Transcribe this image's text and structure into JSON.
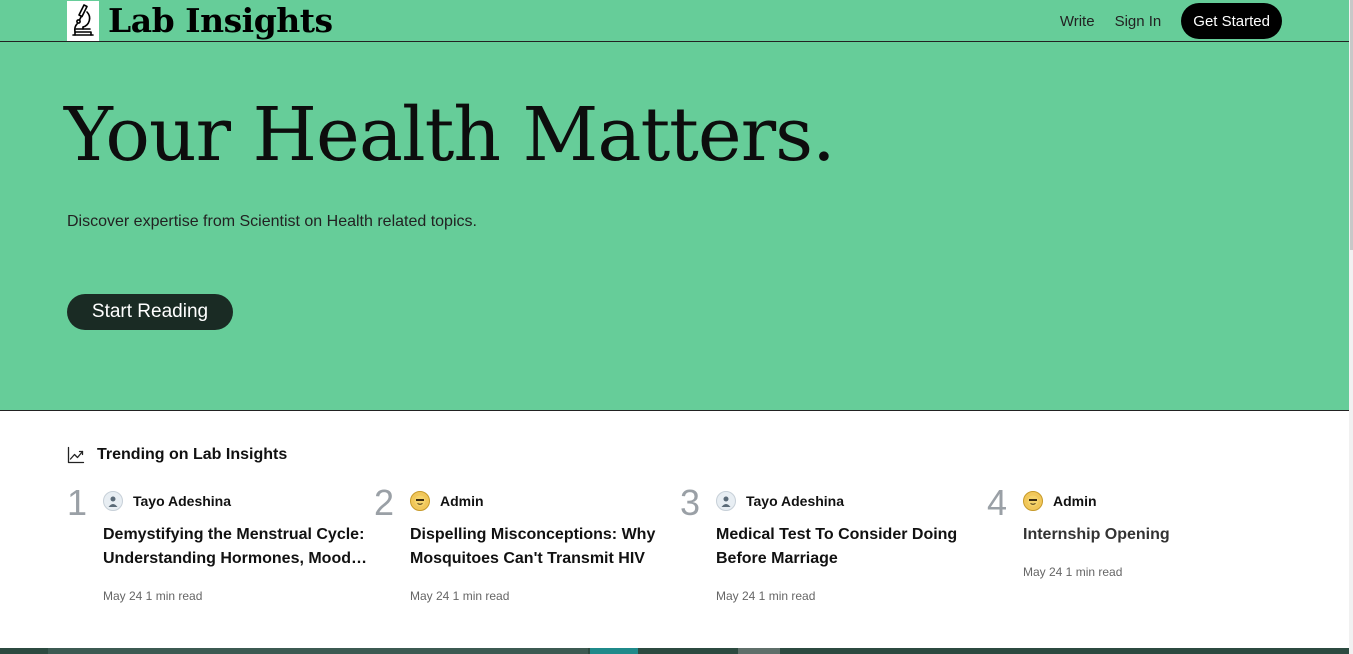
{
  "header": {
    "brand": "Lab Insights",
    "logo_icon": "microscope-icon",
    "nav": {
      "write": "Write",
      "sign_in": "Sign In",
      "get_started": "Get Started"
    }
  },
  "hero": {
    "title": "Your Health Matters.",
    "subtitle": "Discover expertise from Scientist on Health related topics.",
    "cta": "Start Reading"
  },
  "trending": {
    "heading": "Trending on Lab Insights",
    "icon": "trending-up-icon",
    "items": [
      {
        "rank": "1",
        "author": "Tayo Adeshina",
        "title": "Demystifying the Menstrual Cycle: Understanding Hormones, Mood Swings, and Symptoms",
        "meta": "May 24 1 min read"
      },
      {
        "rank": "2",
        "author": "Admin",
        "title": "Dispelling Misconceptions: Why Mosquitoes Can't Transmit HIV",
        "meta": "May 24 1 min read"
      },
      {
        "rank": "3",
        "author": "Tayo Adeshina",
        "title": "Medical Test To Consider Doing Before Marriage",
        "meta": "May 24 1 min read"
      },
      {
        "rank": "4",
        "author": "Admin",
        "title": "Internship Opening",
        "meta": "May 24 1 min read"
      }
    ]
  },
  "colors": {
    "brand_green": "#66cd99",
    "dark": "#1a2b24",
    "black": "#000000"
  }
}
